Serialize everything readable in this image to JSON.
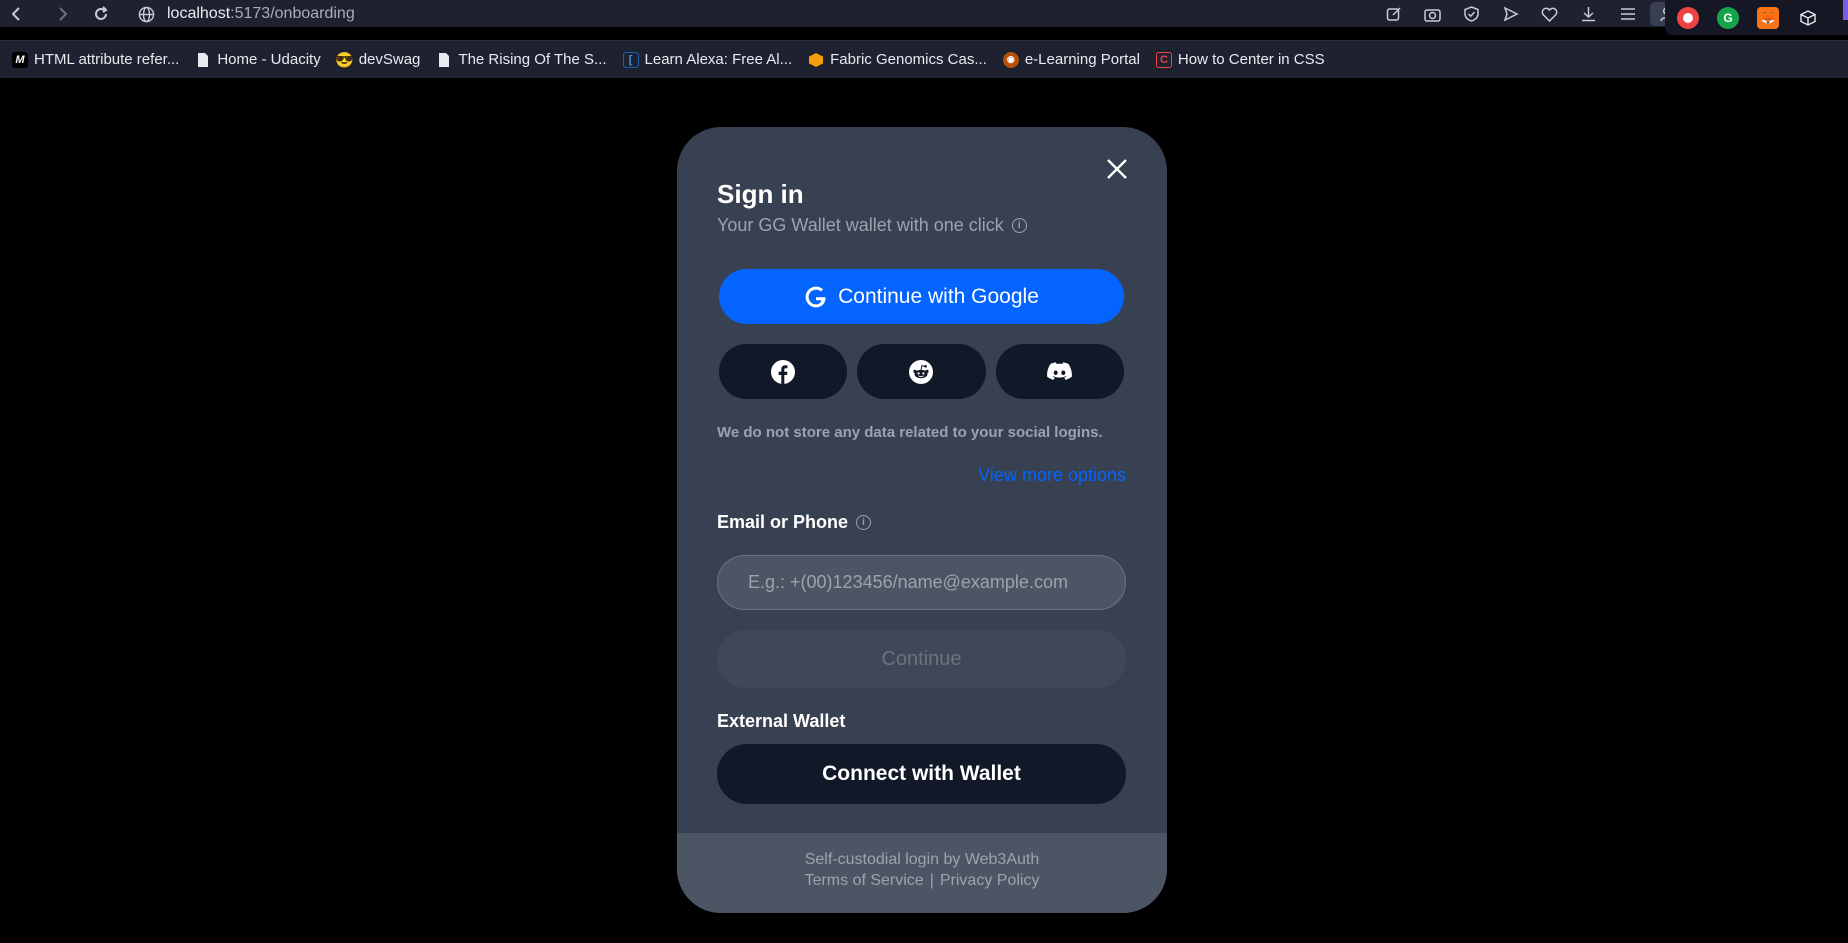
{
  "browser": {
    "url_host": "localhost",
    "url_path": ":5173/onboarding",
    "bookmarks": [
      {
        "label": "HTML attribute refer...",
        "icon": "mdn-icon"
      },
      {
        "label": "Home - Udacity",
        "icon": "page-icon"
      },
      {
        "label": "devSwag",
        "icon": "sunglasses-emoji-icon"
      },
      {
        "label": "The Rising Of The S...",
        "icon": "page-icon"
      },
      {
        "label": "Learn Alexa: Free Al...",
        "icon": "alexa-icon"
      },
      {
        "label": "Fabric Genomics Cas...",
        "icon": "fabric-icon"
      },
      {
        "label": "e-Learning Portal",
        "icon": "portal-icon"
      },
      {
        "label": "How to Center in CSS",
        "icon": "css-c-icon"
      }
    ]
  },
  "modal": {
    "title": "Sign in",
    "subtitle": "Your GG Wallet wallet with one click",
    "google_label": "Continue with Google",
    "social": [
      "facebook-icon",
      "reddit-icon",
      "discord-icon"
    ],
    "notice": "We do not store any data related to your social logins.",
    "more_options": "View more options",
    "email_label": "Email or Phone",
    "email_placeholder": "E.g.: +(00)123456/name@example.com",
    "continue_label": "Continue",
    "external_label": "External Wallet",
    "wallet_label": "Connect with Wallet",
    "footer_line": "Self-custodial login by Web3Auth",
    "terms": "Terms of Service",
    "separator": "|",
    "privacy": "Privacy Policy"
  },
  "colors": {
    "modal_bg": "#374151",
    "accent": "#0364ff",
    "dark_button": "#111827",
    "footer_bg": "#4b5563"
  }
}
